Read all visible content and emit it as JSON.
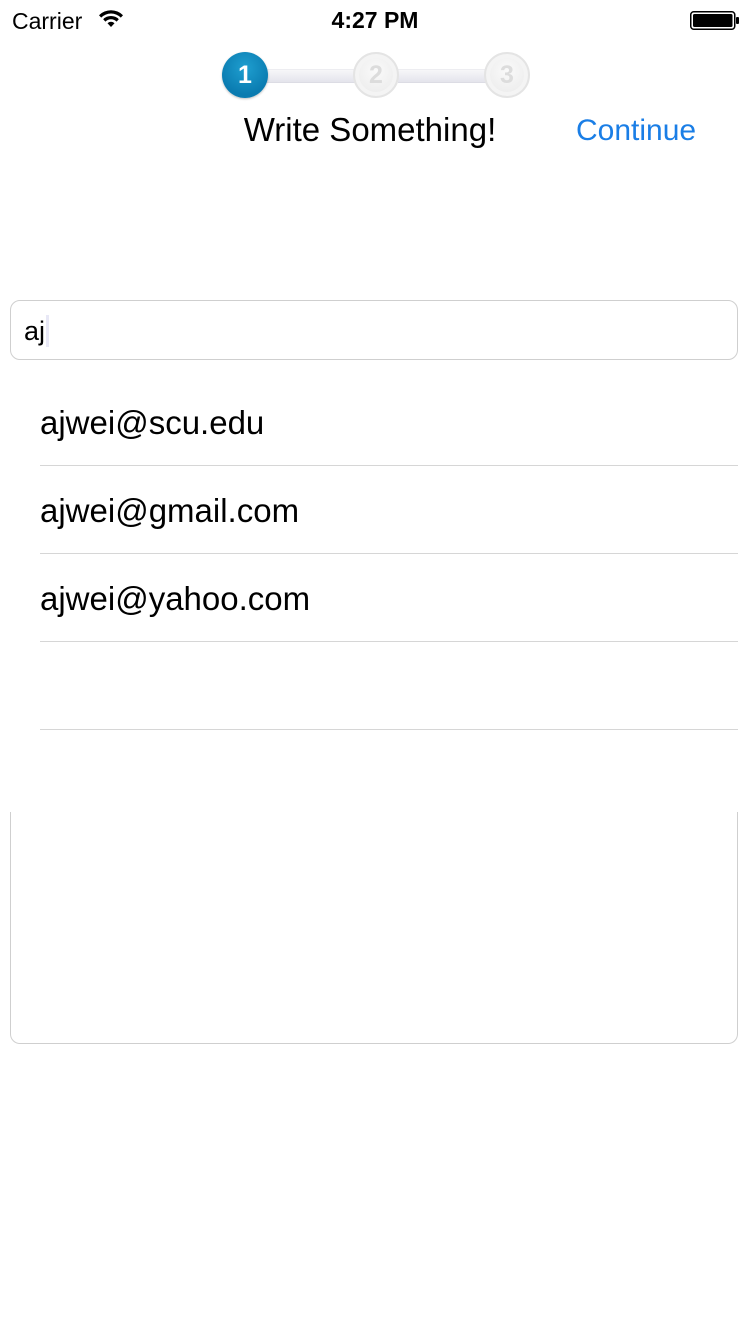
{
  "status_bar": {
    "carrier": "Carrier",
    "time": "4:27 PM",
    "icons": [
      "wifi-icon",
      "battery-icon"
    ]
  },
  "stepper": {
    "steps": [
      "1",
      "2",
      "3"
    ],
    "active_step": 1,
    "colors": {
      "active": "#0a7bb0",
      "inactive": "#ececec"
    }
  },
  "header": {
    "title": "Write Something!",
    "continue_label": "Continue"
  },
  "search": {
    "value": "aj"
  },
  "suggestions": [
    "ajwei@scu.edu",
    "ajwei@gmail.com",
    "ajwei@yahoo.com",
    ""
  ],
  "colors": {
    "accent": "#1a7ee6"
  }
}
